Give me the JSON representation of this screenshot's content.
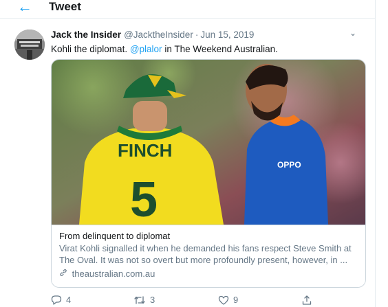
{
  "header": {
    "back_icon": "arrow-left-icon",
    "title": "Tweet"
  },
  "tweet": {
    "author_name": "Jack the Insider",
    "author_handle": "@JacktheInsider",
    "separator": "·",
    "date": "Jun 15, 2019",
    "text_before": "Kohli the diplomat. ",
    "mention": "@plalor",
    "text_after": " in The Weekend Australian.",
    "card": {
      "image_labels": {
        "jersey_name": "FINCH",
        "jersey_number": "5",
        "sponsor": "OPPO"
      },
      "title": "From delinquent to diplomat",
      "description": "Virat Kohli signalled it when he demanded his fans respect Steve Smith at The Oval. It was not so overt but more profoundly present, however, in ...",
      "link_icon": "link-icon",
      "domain": "theaustralian.com.au"
    },
    "actions": {
      "reply_count": "4",
      "retweet_count": "3",
      "like_count": "9"
    }
  },
  "colors": {
    "accent": "#1da1f2",
    "muted": "#657786",
    "border": "#ccd6dd"
  }
}
